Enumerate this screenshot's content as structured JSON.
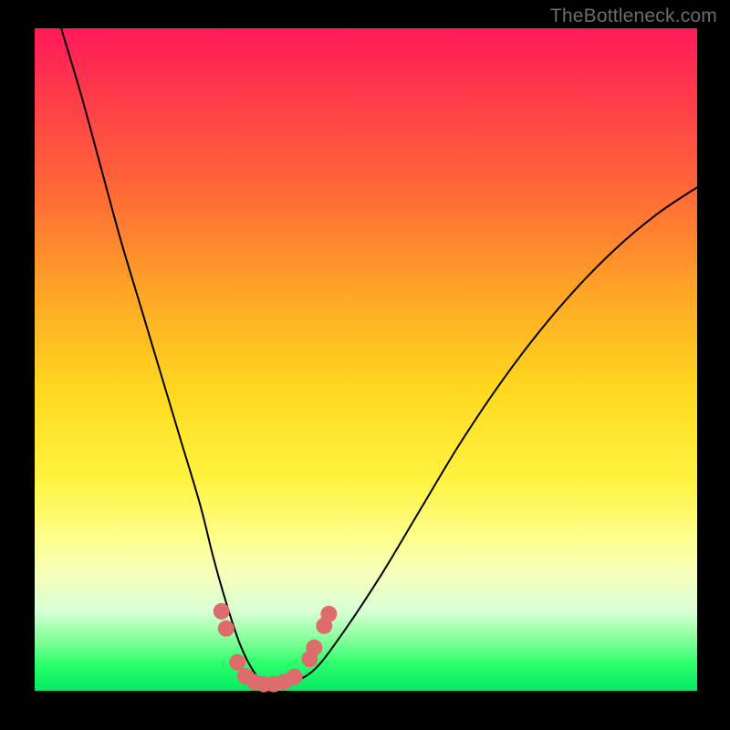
{
  "watermark": "TheBottleneck.com",
  "colors": {
    "curve_stroke": "#000000",
    "marker_fill": "#de6c6c",
    "marker_stroke": "#de6c6c",
    "frame_bg": "#000000"
  },
  "chart_data": {
    "type": "line",
    "title": "",
    "xlabel": "",
    "ylabel": "",
    "xlim": [
      0,
      100
    ],
    "ylim": [
      0,
      100
    ],
    "note": "No axis ticks or numeric labels are rendered; values below are pixel-estimated normalized percentages (x and y in 0–100 of plot area, y=0 at bottom).",
    "series": [
      {
        "name": "curve",
        "x": [
          4,
          7,
          10,
          13,
          16,
          19,
          22,
          25,
          27,
          29,
          31,
          33,
          35,
          38,
          42,
          46,
          52,
          58,
          64,
          70,
          76,
          82,
          88,
          94,
          100
        ],
        "y": [
          100,
          90,
          79,
          68,
          58,
          48,
          38,
          28,
          20,
          13,
          7,
          3,
          1,
          1,
          3,
          8,
          17,
          27,
          37,
          46,
          54,
          61,
          67,
          72,
          76
        ]
      }
    ],
    "markers": {
      "name": "cluster-near-minimum",
      "points": [
        {
          "x": 28.2,
          "y": 12.0
        },
        {
          "x": 28.9,
          "y": 9.4
        },
        {
          "x": 30.6,
          "y": 4.3
        },
        {
          "x": 31.8,
          "y": 2.2
        },
        {
          "x": 33.2,
          "y": 1.3
        },
        {
          "x": 34.6,
          "y": 1.0
        },
        {
          "x": 36.1,
          "y": 1.0
        },
        {
          "x": 37.6,
          "y": 1.3
        },
        {
          "x": 39.2,
          "y": 2.1
        },
        {
          "x": 41.5,
          "y": 4.8
        },
        {
          "x": 42.2,
          "y": 6.5
        },
        {
          "x": 43.7,
          "y": 9.8
        },
        {
          "x": 44.4,
          "y": 11.6
        }
      ]
    }
  }
}
